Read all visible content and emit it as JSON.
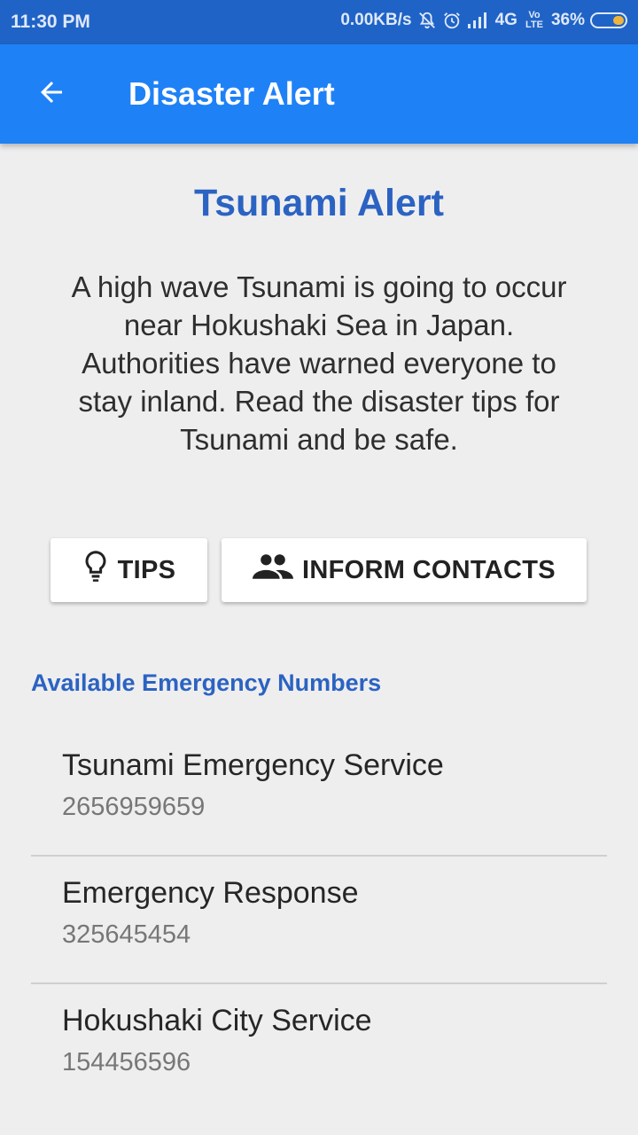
{
  "status_bar": {
    "time": "11:30 PM",
    "network_speed": "0.00KB/s",
    "network_type": "4G",
    "volte": "Vo LTE",
    "battery_percent": "36%",
    "battery_level": 0.36,
    "icons": [
      "mute-icon",
      "alarm-icon",
      "signal-icon",
      "battery-icon"
    ]
  },
  "app_bar": {
    "title": "Disaster Alert",
    "back_icon": "arrow-back-icon",
    "color": "#1f81f6"
  },
  "alert": {
    "title": "Tsunami Alert",
    "message": "A high wave Tsunami is going to occur near Hokushaki Sea in Japan. Authorities have warned everyone to stay inland. Read the disaster tips for Tsunami and be safe.",
    "title_color": "#2b63c2"
  },
  "actions": {
    "tips_label": "TIPS",
    "tips_icon": "lightbulb-icon",
    "inform_label": "INFORM CONTACTS",
    "inform_icon": "people-icon"
  },
  "emergency": {
    "header": "Available Emergency Numbers",
    "numbers": [
      {
        "name": "Tsunami Emergency Service",
        "number": "2656959659"
      },
      {
        "name": "Emergency Response",
        "number": "325645454"
      },
      {
        "name": "Hokushaki City Service",
        "number": "154456596"
      }
    ]
  }
}
